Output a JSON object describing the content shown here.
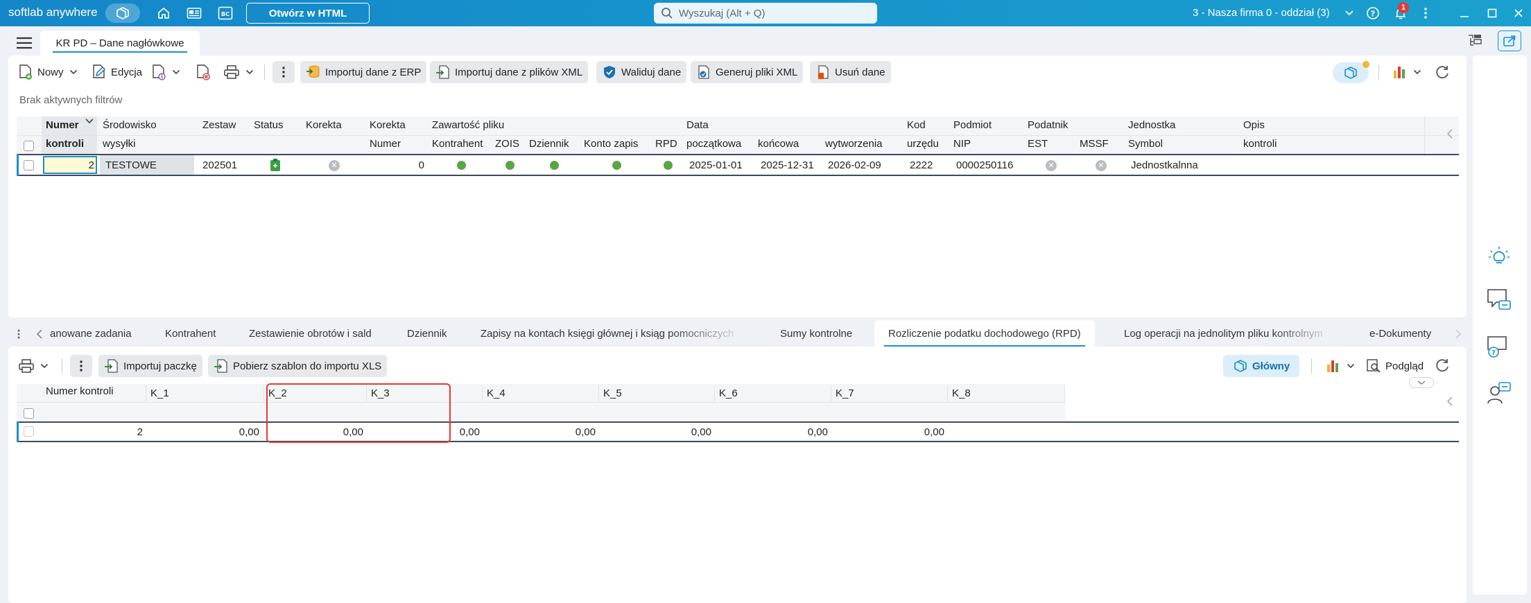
{
  "titlebar": {
    "brand": "softlab anywhere",
    "open_html": "Otwórz w HTML",
    "search_placeholder": "Wyszukaj (Alt + Q)",
    "company": "3 - Nasza firma 0 - oddział (3)",
    "notification_count": "1",
    "bc_label": "BC"
  },
  "doc_tab": {
    "label": "KR PD – Dane nagłówkowe"
  },
  "toolbar": {
    "nowy": "Nowy",
    "edycja": "Edycja",
    "import_erp": "Importuj dane z ERP",
    "import_xml": "Importuj dane z plików XML",
    "waliduj": "Waliduj dane",
    "generuj": "Generuj pliki XML",
    "usun": "Usuń dane"
  },
  "filter_text": "Brak aktywnych filtrów",
  "top_grid": {
    "headers1": [
      "Numer",
      "Środowisko",
      "Zestaw",
      "Status",
      "Korekta",
      "Korekta",
      "Zawartość pliku",
      "Data",
      "Kod",
      "Podmiot",
      "Podatnik",
      "Jednostka",
      "Opis"
    ],
    "headers2": [
      "kontroli",
      "wysyłki",
      "Numer",
      "Kontrahent",
      "ZOIS",
      "Dziennik",
      "Konto zapis",
      "RPD",
      "początkowa",
      "końcowa",
      "wytworzenia",
      "urzędu",
      "NIP",
      "EST",
      "MSSF",
      "Symbol",
      "kontroli"
    ],
    "row": {
      "numer": "2",
      "srodowisko": "TESTOWE",
      "zestaw": "202501",
      "korekta_numer": "0",
      "data_pocz": "2025-01-01",
      "data_konc": "2025-12-31",
      "data_wytw": "2026-02-09",
      "kod_urzedu": "2222",
      "nip": "0000250116",
      "symbol": "Jednostkalnna"
    }
  },
  "bottom_tabs": [
    "anowane zadania",
    "Kontrahent",
    "Zestawienie obrotów i sald",
    "Dziennik",
    "Zapisy na kontach księgi głównej i ksiąg pomocniczych",
    "Sumy kontrolne",
    "Rozliczenie podatku dochodowego (RPD)",
    "Log operacji na jednolitym pliku kontrolnym",
    "e-Dokumenty"
  ],
  "bottom_toolbar": {
    "import_paczke": "Importuj paczkę",
    "pobierz": "Pobierz szablon do importu XLS",
    "glowny": "Główny",
    "podglad": "Podgląd"
  },
  "bottom_grid": {
    "headers": [
      "Numer kontroli",
      "K_1",
      "K_2",
      "K_3",
      "K_4",
      "K_5",
      "K_6",
      "K_7",
      "K_8"
    ],
    "row": [
      "2",
      "0,00",
      "0,00",
      "0,00",
      "0,00",
      "0,00",
      "0,00",
      "0,00"
    ]
  },
  "colors": {
    "accent": "#1a8fd0",
    "titlebar": "#1487c9",
    "highlight_box": "#e53935",
    "status_ok": "#5aa545"
  }
}
